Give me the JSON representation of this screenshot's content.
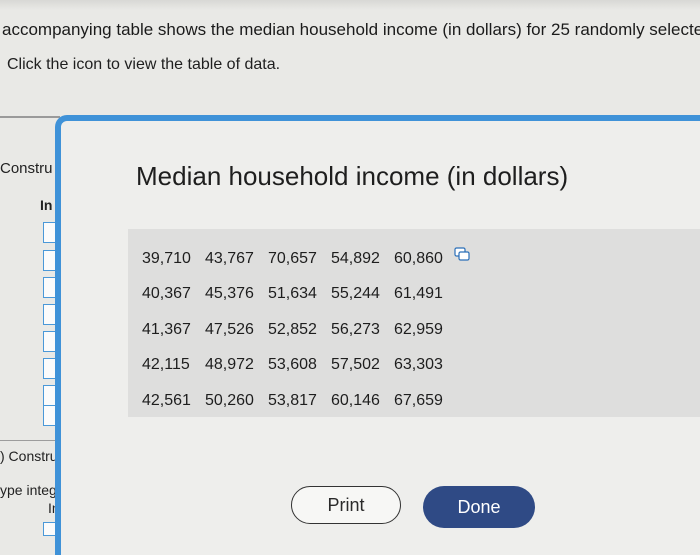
{
  "question": {
    "text": "accompanying table shows the median household income (in dollars) for 25 randomly selected re",
    "instruction": "Click the icon to view the table of data."
  },
  "background": {
    "construct_label_1": "Constru",
    "input_label_1": "In",
    "construct_label_2": ") Constru",
    "type_label": "ype integ",
    "input_label_2": "In"
  },
  "dialog": {
    "title": "Median household income (in dollars)",
    "table": [
      [
        "39,710",
        "43,767",
        "70,657",
        "54,892",
        "60,860"
      ],
      [
        "40,367",
        "45,376",
        "51,634",
        "55,244",
        "61,491"
      ],
      [
        "41,367",
        "47,526",
        "52,852",
        "56,273",
        "62,959"
      ],
      [
        "42,115",
        "48,972",
        "53,608",
        "57,502",
        "63,303"
      ],
      [
        "42,561",
        "50,260",
        "53,817",
        "60,146",
        "67,659"
      ]
    ],
    "copy_icon": "copy-icon",
    "print_label": "Print",
    "done_label": "Done"
  },
  "colors": {
    "dialog_border": "#3f92d8",
    "done_button": "#2f4a85",
    "input_border": "#4a98d8"
  }
}
